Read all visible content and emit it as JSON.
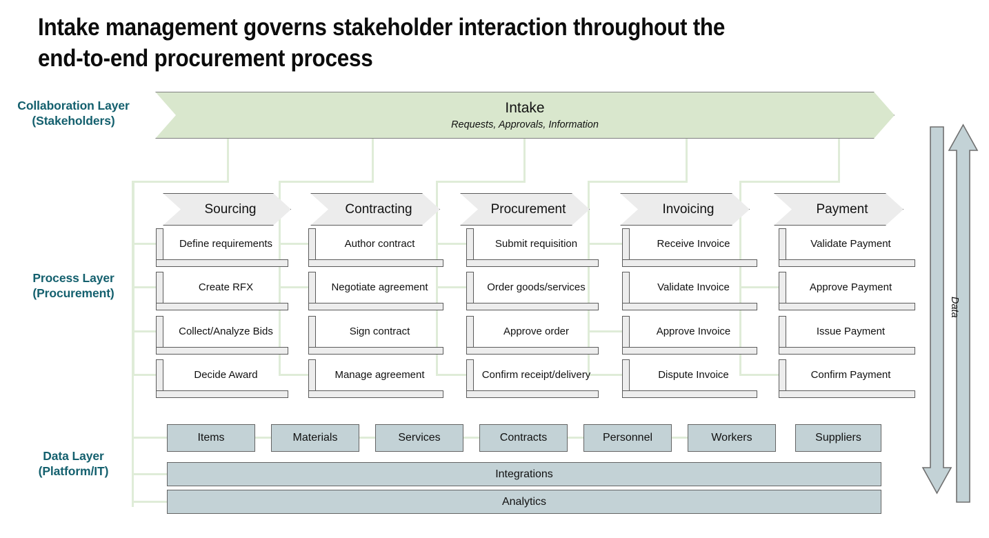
{
  "title": "Intake management governs stakeholder interaction throughout the\nend-to-end procurement process",
  "colors": {
    "teal_label": "#14606e",
    "banner_green": "#d9e7cd",
    "connector_green": "#dfecd8",
    "task_gray": "#ededed",
    "phase_gray": "#ececec",
    "data_blue": "#c3d2d6",
    "border_gray": "#5a5a5a"
  },
  "layers": {
    "collaboration": {
      "label": "Collaboration Layer\n(Stakeholders)"
    },
    "process": {
      "label": "Process Layer\n(Procurement)"
    },
    "data": {
      "label": "Data Layer\n(Platform/IT)"
    }
  },
  "banner": {
    "title": "Intake",
    "subtitle": "Requests, Approvals, Information"
  },
  "columns": [
    {
      "phase": "Sourcing",
      "tasks": [
        "Define requirements",
        "Create RFX",
        "Collect/Analyze Bids",
        "Decide Award"
      ]
    },
    {
      "phase": "Contracting",
      "tasks": [
        "Author contract",
        "Negotiate agreement",
        "Sign contract",
        "Manage agreement"
      ]
    },
    {
      "phase": "Procurement",
      "tasks": [
        "Submit requisition",
        "Order goods/services",
        "Approve order",
        "Confirm receipt/delivery"
      ]
    },
    {
      "phase": "Invoicing",
      "tasks": [
        "Receive Invoice",
        "Validate Invoice",
        "Approve Invoice",
        "Dispute Invoice"
      ]
    },
    {
      "phase": "Payment",
      "tasks": [
        "Validate Payment",
        "Approve Payment",
        "Issue Payment",
        "Confirm Payment"
      ]
    }
  ],
  "data_layer": {
    "chips": [
      "Items",
      "Materials",
      "Services",
      "Contracts",
      "Personnel",
      "Workers",
      "Suppliers"
    ],
    "bars": [
      "Integrations",
      "Analytics"
    ]
  },
  "flow_arrows": {
    "label": "Data",
    "down_arrow": "data-down-arrow",
    "up_arrow": "data-up-arrow"
  }
}
